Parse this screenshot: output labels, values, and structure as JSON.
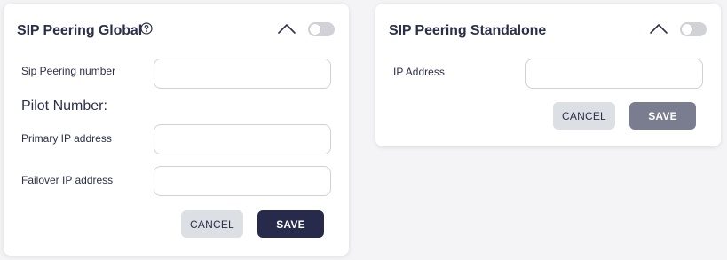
{
  "colors": {
    "card_bg": "#ffffff",
    "page_bg": "#f4f4f6",
    "title_text": "#2c2f4a",
    "save_primary": "#272a4b",
    "save_disabled": "#7a7c8f",
    "cancel_bg": "#dcdfe4",
    "toggle_off": "#d0d2d6"
  },
  "global": {
    "title": "SIP Peering Global",
    "help_icon": "question-circle-icon",
    "collapse_icon": "chevron-up-icon",
    "toggle_state": "off",
    "sip_peering_number_label": "Sip Peering number",
    "sip_peering_number_value": "",
    "pilot_number_label": "Pilot Number:",
    "primary_ip_label": "Primary IP address",
    "primary_ip_value": "",
    "failover_ip_label": "Failover IP address",
    "failover_ip_value": "",
    "cancel_label": "CANCEL",
    "save_label": "SAVE"
  },
  "standalone": {
    "title": "SIP Peering Standalone",
    "collapse_icon": "chevron-up-icon",
    "toggle_state": "off",
    "ip_address_label": "IP Address",
    "ip_address_value": "",
    "cancel_label": "CANCEL",
    "save_label": "SAVE"
  }
}
